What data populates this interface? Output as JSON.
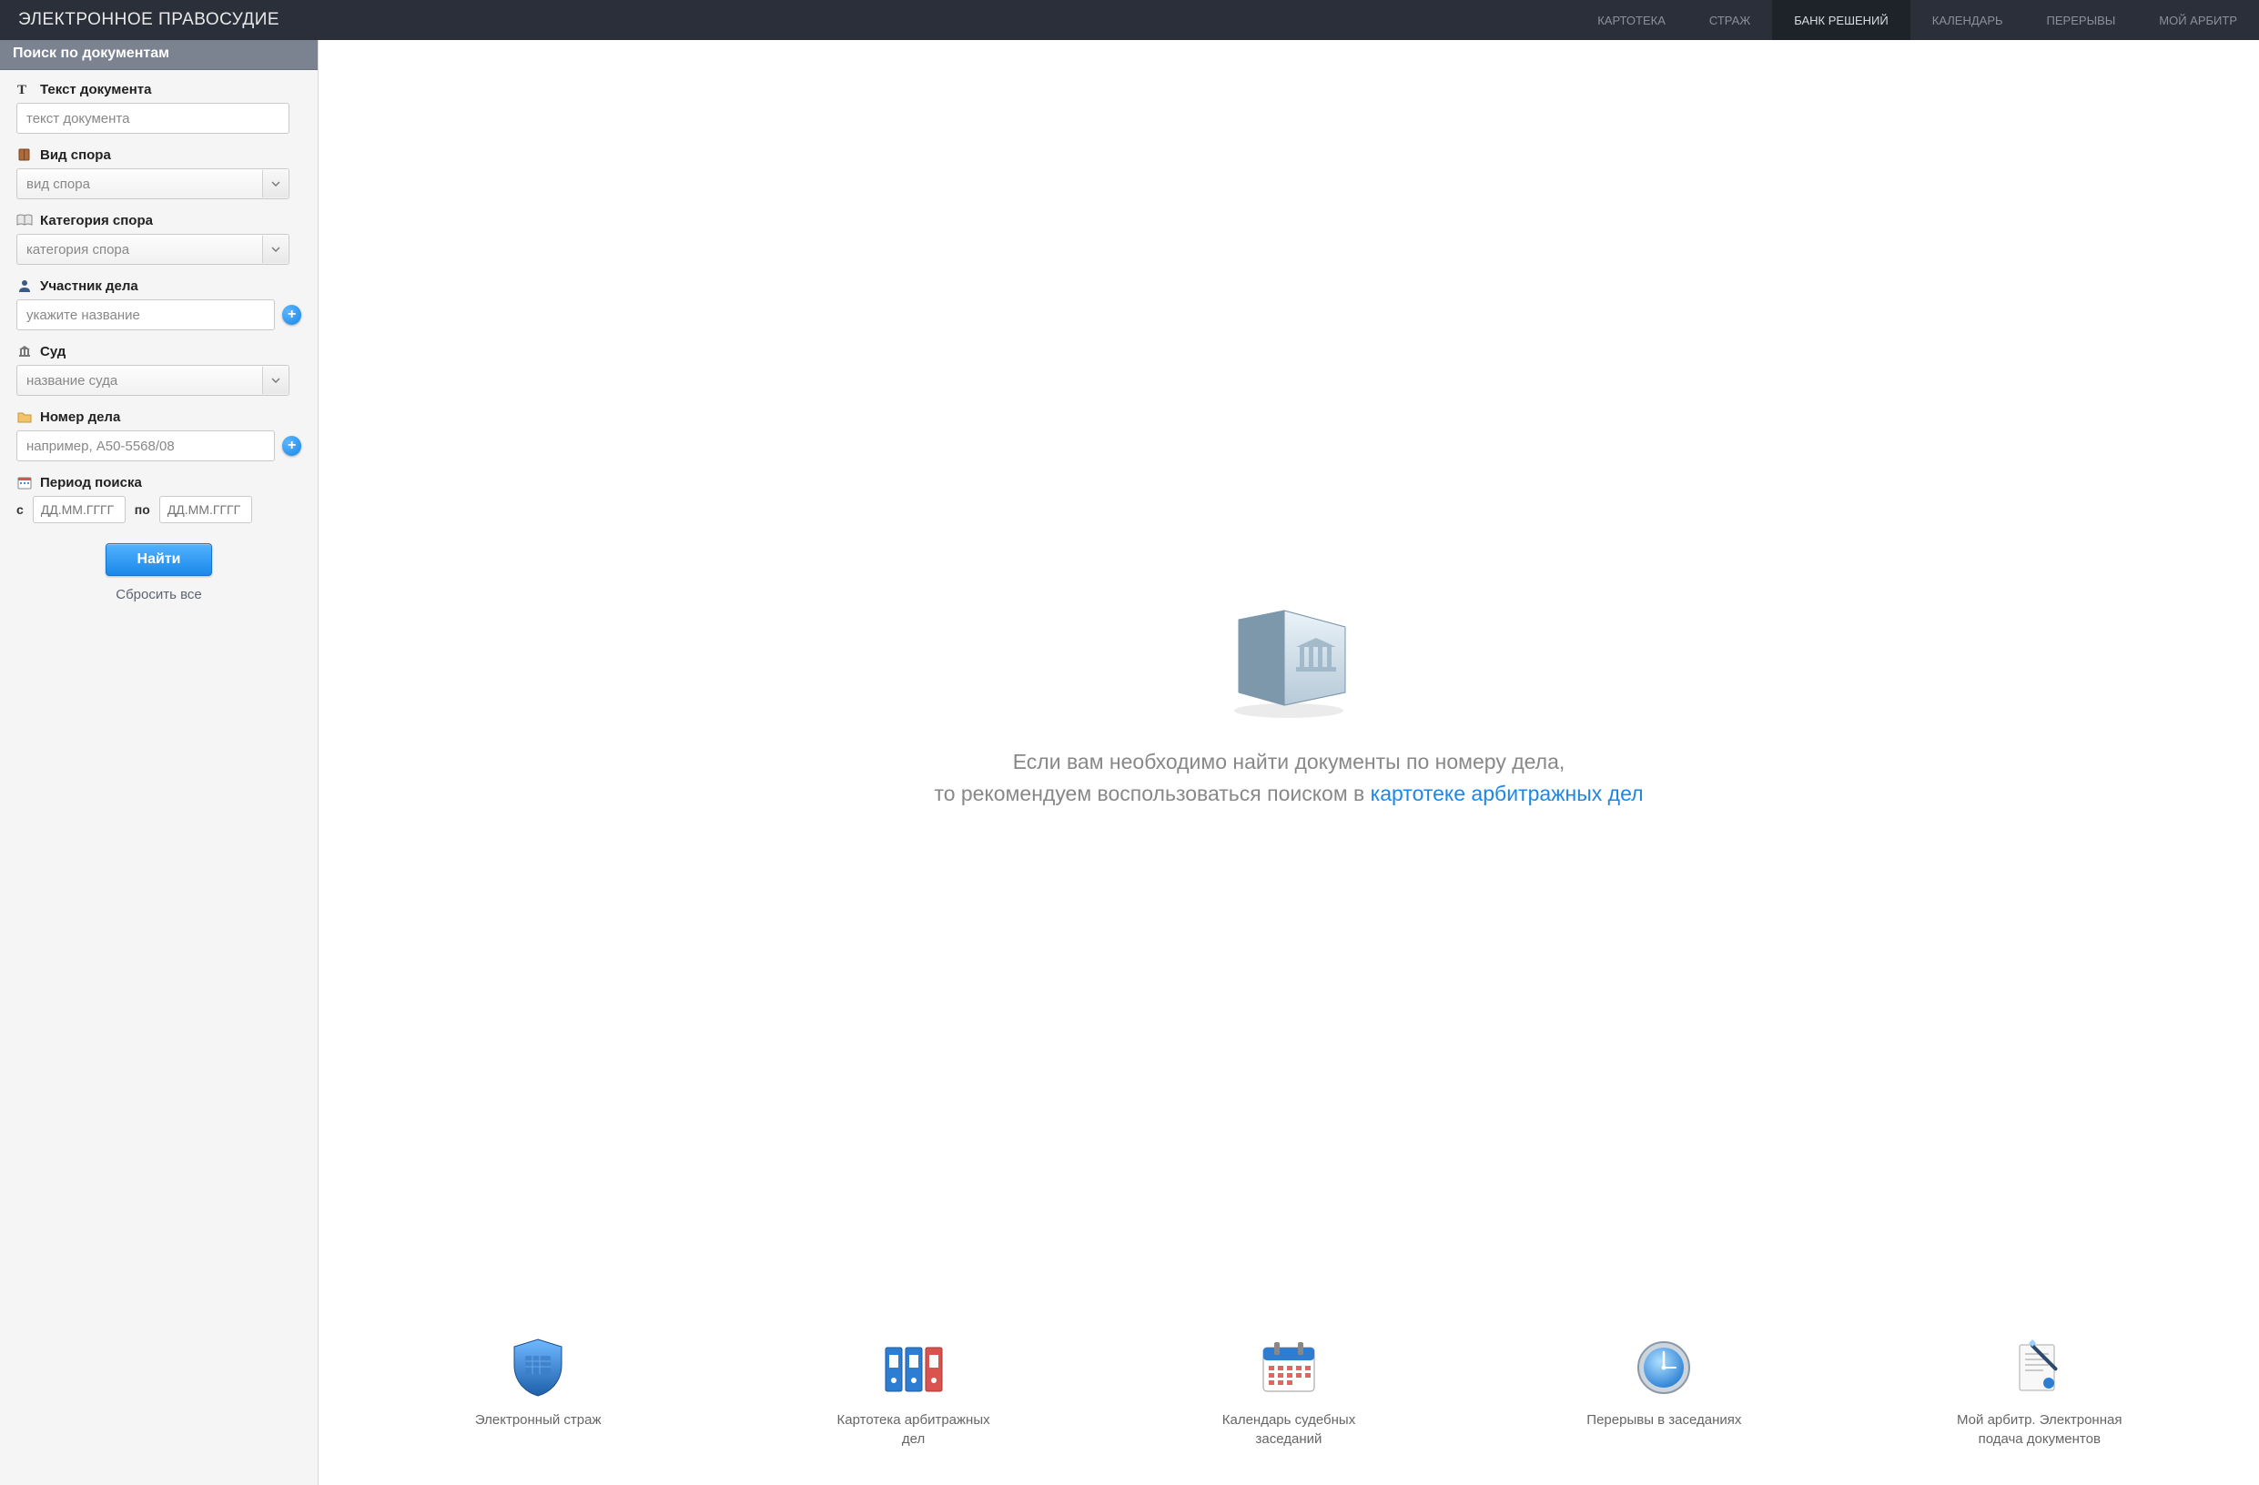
{
  "brand": "ЭЛЕКТРОННОЕ ПРАВОСУДИЕ",
  "nav": {
    "items": [
      {
        "label": "КАРТОТЕКА",
        "active": false
      },
      {
        "label": "СТРАЖ",
        "active": false
      },
      {
        "label": "БАНК РЕШЕНИЙ",
        "active": true
      },
      {
        "label": "КАЛЕНДАРЬ",
        "active": false
      },
      {
        "label": "ПЕРЕРЫВЫ",
        "active": false
      },
      {
        "label": "МОЙ АРБИТР",
        "active": false
      }
    ]
  },
  "sidebar": {
    "title": "Поиск по документам",
    "fields": {
      "doc_text": {
        "label": "Текст документа",
        "placeholder": "текст документа"
      },
      "dispute_type": {
        "label": "Вид спора",
        "placeholder": "вид спора"
      },
      "dispute_category": {
        "label": "Категория спора",
        "placeholder": "категория спора"
      },
      "participant": {
        "label": "Участник дела",
        "placeholder": "укажите название"
      },
      "court": {
        "label": "Суд",
        "placeholder": "название суда"
      },
      "case_number": {
        "label": "Номер дела",
        "placeholder": "например, А50-5568/08"
      },
      "period": {
        "label": "Период поиска",
        "from_label": "с",
        "to_label": "по",
        "placeholder": "ДД.ММ.ГГГГ"
      }
    },
    "search_button": "Найти",
    "reset_link": "Сбросить все"
  },
  "main": {
    "hero": {
      "line1": "Если вам необходимо найти документы по номеру дела,",
      "line2_prefix": "то рекомендуем воспользоваться поиском в ",
      "line2_link": "картотеке арбитражных дел"
    },
    "tiles": [
      {
        "label": "Электронный страж"
      },
      {
        "label": "Картотека арбитражных дел"
      },
      {
        "label": "Календарь судебных заседаний"
      },
      {
        "label": "Перерывы в заседаниях"
      },
      {
        "label": "Мой арбитр. Электронная подача документов"
      }
    ]
  }
}
